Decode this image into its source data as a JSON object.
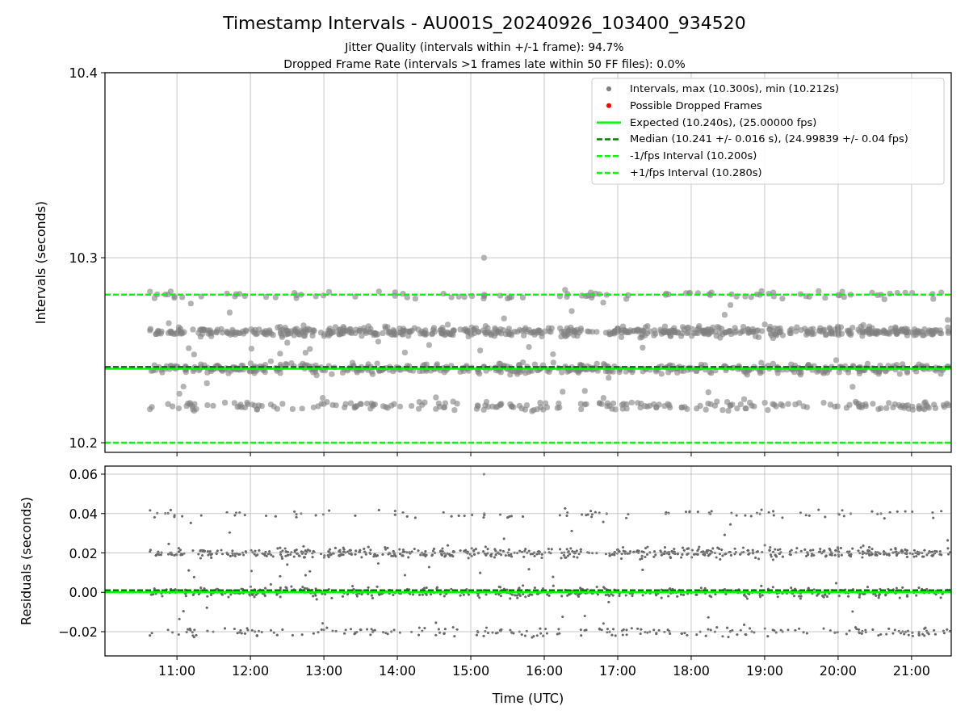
{
  "title": "Timestamp Intervals - AU001S_20240926_103400_934520",
  "subtitles": [
    "Jitter Quality (intervals within +/-1 frame): 94.7%",
    "Dropped Frame Rate (intervals >1 frames late within 50 FF files): 0.0%"
  ],
  "intervals_panel": {
    "legend_markers": [
      {
        "label": "Intervals, max (10.300s), min (10.212s)",
        "color": "#808080"
      },
      {
        "label": "Possible Dropped Frames",
        "color": "#ff0000"
      }
    ],
    "chart_data": {
      "type": "line",
      "ylabel": "Intervals (seconds)",
      "xlim": [
        10.02,
        21.54
      ],
      "ylim": [
        10.1948,
        10.4
      ],
      "grid": true,
      "legend": "upper right",
      "yticks": [
        {
          "value": 10.2,
          "label": "10.2"
        },
        {
          "value": 10.3,
          "label": "10.3"
        },
        {
          "value": 10.4,
          "label": "10.4"
        }
      ],
      "x": [
        10.02,
        21.54
      ],
      "series": [
        {
          "name": "Expected (10.240s), (25.00000 fps)",
          "color": "#00ff00",
          "line_style": "solid",
          "values": [
            10.24,
            10.24
          ]
        },
        {
          "name": "Median (10.241 +/- 0.016 s), (24.99839 +/- 0.04 fps)",
          "color": "#008000",
          "line_style": "dashed",
          "values": [
            10.241,
            10.241
          ]
        },
        {
          "name": "-1/fps Interval (10.200s)",
          "color": "#00ff00",
          "line_style": "dashed",
          "values": [
            10.2,
            10.2
          ]
        },
        {
          "name": "+1/fps Interval (10.280s)",
          "color": "#00ff00",
          "line_style": "dashed",
          "values": [
            10.28,
            10.28
          ]
        }
      ]
    }
  },
  "residuals_panel": {
    "chart_data": {
      "type": "line",
      "xlabel": "Time (UTC)",
      "ylabel": "Residuals (seconds)",
      "xlim": [
        10.02,
        21.54
      ],
      "ylim": [
        -0.0323,
        0.0641
      ],
      "grid": true,
      "xticks": [
        {
          "value": 11,
          "label": "11:00"
        },
        {
          "value": 12,
          "label": "12:00"
        },
        {
          "value": 13,
          "label": "13:00"
        },
        {
          "value": 14,
          "label": "14:00"
        },
        {
          "value": 15,
          "label": "15:00"
        },
        {
          "value": 16,
          "label": "16:00"
        },
        {
          "value": 17,
          "label": "17:00"
        },
        {
          "value": 18,
          "label": "18:00"
        },
        {
          "value": 19,
          "label": "19:00"
        },
        {
          "value": 20,
          "label": "20:00"
        },
        {
          "value": 21,
          "label": "21:00"
        }
      ],
      "yticks": [
        {
          "value": -0.02,
          "label": "−0.02"
        },
        {
          "value": 0,
          "label": "0.00"
        },
        {
          "value": 0.02,
          "label": "0.02"
        },
        {
          "value": 0.04,
          "label": "0.04"
        },
        {
          "value": 0.06,
          "label": "0.06"
        }
      ],
      "x": [
        10.02,
        21.54
      ],
      "series": [
        {
          "color": "#00ff00",
          "line_style": "solid",
          "values": [
            0,
            0
          ]
        },
        {
          "color": "#008000",
          "line_style": "dashed",
          "values": [
            0.001,
            0.001
          ]
        }
      ]
    }
  }
}
